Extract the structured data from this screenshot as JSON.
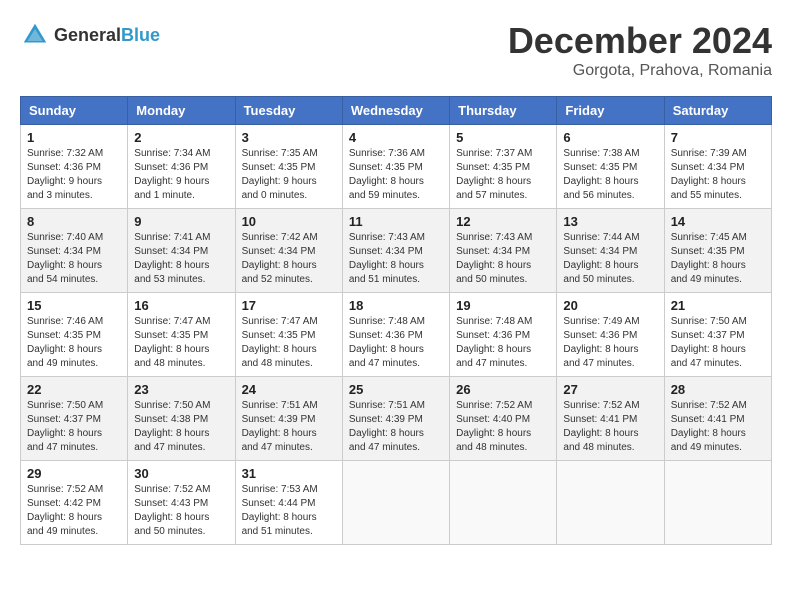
{
  "header": {
    "logo_general": "General",
    "logo_blue": "Blue",
    "month_title": "December 2024",
    "location": "Gorgota, Prahova, Romania"
  },
  "weekdays": [
    "Sunday",
    "Monday",
    "Tuesday",
    "Wednesday",
    "Thursday",
    "Friday",
    "Saturday"
  ],
  "weeks": [
    [
      {
        "day": "1",
        "sunrise": "7:32 AM",
        "sunset": "4:36 PM",
        "daylight": "9 hours and 3 minutes."
      },
      {
        "day": "2",
        "sunrise": "7:34 AM",
        "sunset": "4:36 PM",
        "daylight": "9 hours and 1 minute."
      },
      {
        "day": "3",
        "sunrise": "7:35 AM",
        "sunset": "4:35 PM",
        "daylight": "9 hours and 0 minutes."
      },
      {
        "day": "4",
        "sunrise": "7:36 AM",
        "sunset": "4:35 PM",
        "daylight": "8 hours and 59 minutes."
      },
      {
        "day": "5",
        "sunrise": "7:37 AM",
        "sunset": "4:35 PM",
        "daylight": "8 hours and 57 minutes."
      },
      {
        "day": "6",
        "sunrise": "7:38 AM",
        "sunset": "4:35 PM",
        "daylight": "8 hours and 56 minutes."
      },
      {
        "day": "7",
        "sunrise": "7:39 AM",
        "sunset": "4:34 PM",
        "daylight": "8 hours and 55 minutes."
      }
    ],
    [
      {
        "day": "8",
        "sunrise": "7:40 AM",
        "sunset": "4:34 PM",
        "daylight": "8 hours and 54 minutes."
      },
      {
        "day": "9",
        "sunrise": "7:41 AM",
        "sunset": "4:34 PM",
        "daylight": "8 hours and 53 minutes."
      },
      {
        "day": "10",
        "sunrise": "7:42 AM",
        "sunset": "4:34 PM",
        "daylight": "8 hours and 52 minutes."
      },
      {
        "day": "11",
        "sunrise": "7:43 AM",
        "sunset": "4:34 PM",
        "daylight": "8 hours and 51 minutes."
      },
      {
        "day": "12",
        "sunrise": "7:43 AM",
        "sunset": "4:34 PM",
        "daylight": "8 hours and 50 minutes."
      },
      {
        "day": "13",
        "sunrise": "7:44 AM",
        "sunset": "4:34 PM",
        "daylight": "8 hours and 50 minutes."
      },
      {
        "day": "14",
        "sunrise": "7:45 AM",
        "sunset": "4:35 PM",
        "daylight": "8 hours and 49 minutes."
      }
    ],
    [
      {
        "day": "15",
        "sunrise": "7:46 AM",
        "sunset": "4:35 PM",
        "daylight": "8 hours and 49 minutes."
      },
      {
        "day": "16",
        "sunrise": "7:47 AM",
        "sunset": "4:35 PM",
        "daylight": "8 hours and 48 minutes."
      },
      {
        "day": "17",
        "sunrise": "7:47 AM",
        "sunset": "4:35 PM",
        "daylight": "8 hours and 48 minutes."
      },
      {
        "day": "18",
        "sunrise": "7:48 AM",
        "sunset": "4:36 PM",
        "daylight": "8 hours and 47 minutes."
      },
      {
        "day": "19",
        "sunrise": "7:48 AM",
        "sunset": "4:36 PM",
        "daylight": "8 hours and 47 minutes."
      },
      {
        "day": "20",
        "sunrise": "7:49 AM",
        "sunset": "4:36 PM",
        "daylight": "8 hours and 47 minutes."
      },
      {
        "day": "21",
        "sunrise": "7:50 AM",
        "sunset": "4:37 PM",
        "daylight": "8 hours and 47 minutes."
      }
    ],
    [
      {
        "day": "22",
        "sunrise": "7:50 AM",
        "sunset": "4:37 PM",
        "daylight": "8 hours and 47 minutes."
      },
      {
        "day": "23",
        "sunrise": "7:50 AM",
        "sunset": "4:38 PM",
        "daylight": "8 hours and 47 minutes."
      },
      {
        "day": "24",
        "sunrise": "7:51 AM",
        "sunset": "4:39 PM",
        "daylight": "8 hours and 47 minutes."
      },
      {
        "day": "25",
        "sunrise": "7:51 AM",
        "sunset": "4:39 PM",
        "daylight": "8 hours and 47 minutes."
      },
      {
        "day": "26",
        "sunrise": "7:52 AM",
        "sunset": "4:40 PM",
        "daylight": "8 hours and 48 minutes."
      },
      {
        "day": "27",
        "sunrise": "7:52 AM",
        "sunset": "4:41 PM",
        "daylight": "8 hours and 48 minutes."
      },
      {
        "day": "28",
        "sunrise": "7:52 AM",
        "sunset": "4:41 PM",
        "daylight": "8 hours and 49 minutes."
      }
    ],
    [
      {
        "day": "29",
        "sunrise": "7:52 AM",
        "sunset": "4:42 PM",
        "daylight": "8 hours and 49 minutes."
      },
      {
        "day": "30",
        "sunrise": "7:52 AM",
        "sunset": "4:43 PM",
        "daylight": "8 hours and 50 minutes."
      },
      {
        "day": "31",
        "sunrise": "7:53 AM",
        "sunset": "4:44 PM",
        "daylight": "8 hours and 51 minutes."
      },
      null,
      null,
      null,
      null
    ]
  ]
}
